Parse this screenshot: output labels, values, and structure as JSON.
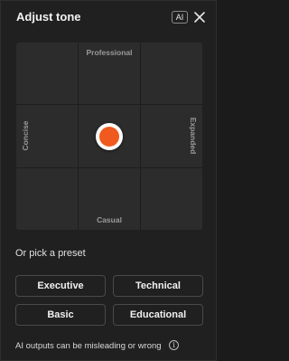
{
  "header": {
    "title": "Adjust tone",
    "ai_badge": "AI",
    "close_icon": "close-icon"
  },
  "tone_grid": {
    "top_label": "Professional",
    "bottom_label": "Casual",
    "left_label": "Concise",
    "right_label": "Expanded",
    "handle_color": "#f05a1e",
    "handle_position": {
      "horizontal": 0.5,
      "vertical": 0.5
    }
  },
  "presets": {
    "heading": "Or pick a preset",
    "items": [
      {
        "label": "Executive"
      },
      {
        "label": "Technical"
      },
      {
        "label": "Basic"
      },
      {
        "label": "Educational"
      }
    ]
  },
  "footer": {
    "disclaimer": "AI outputs can be misleading or wrong",
    "info_icon": "info-icon",
    "info_glyph": "i"
  }
}
